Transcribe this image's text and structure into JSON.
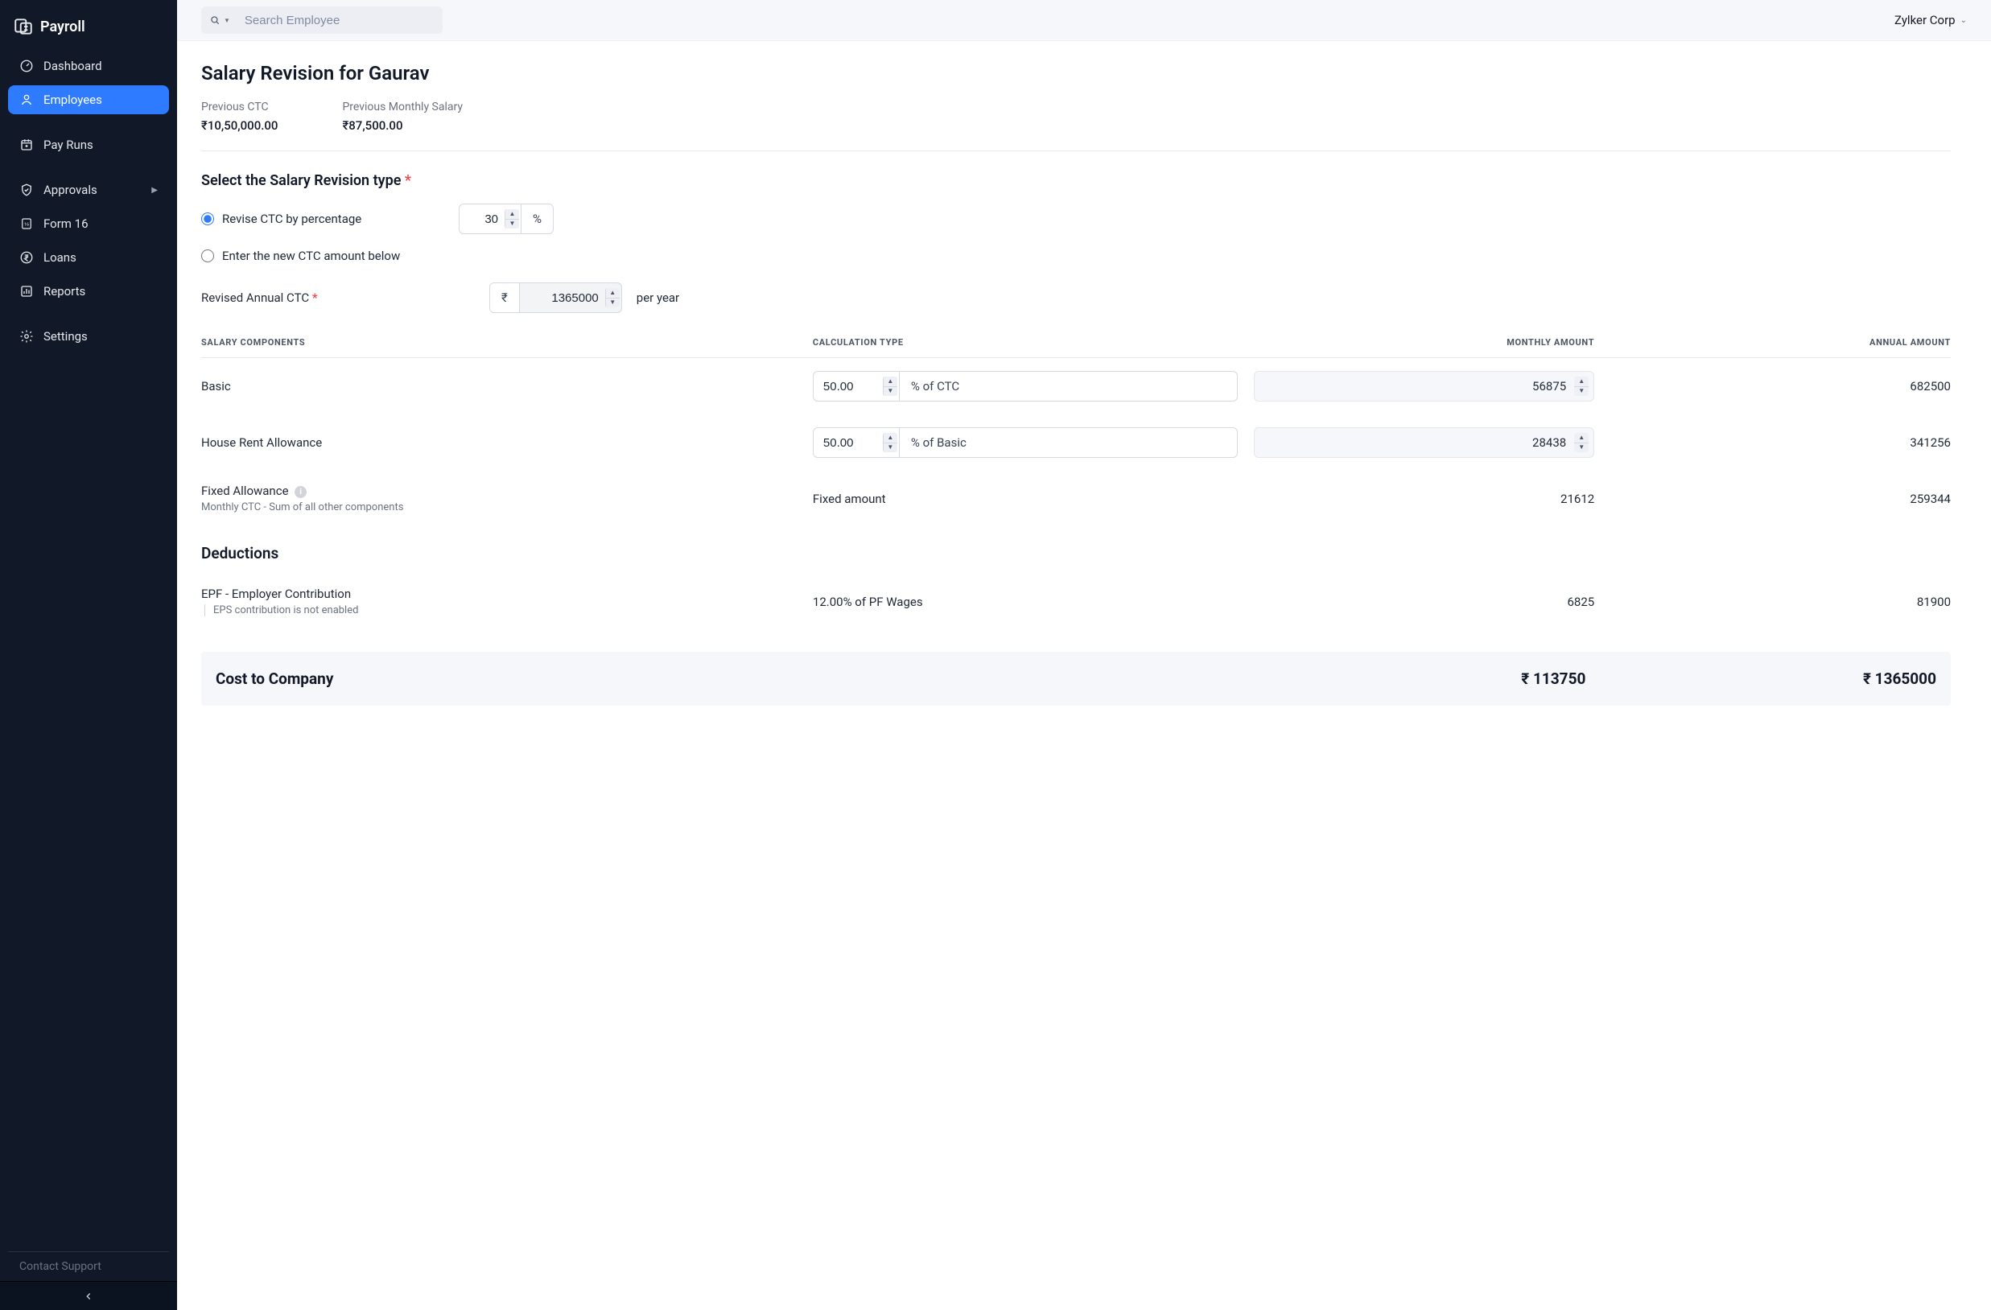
{
  "brand": {
    "name": "Payroll"
  },
  "sidebar": {
    "dashboard": "Dashboard",
    "employees": "Employees",
    "payruns": "Pay Runs",
    "approvals": "Approvals",
    "form16": "Form 16",
    "loans": "Loans",
    "reports": "Reports",
    "settings": "Settings",
    "support": "Contact Support"
  },
  "topbar": {
    "search_placeholder": "Search Employee",
    "org": "Zylker Corp"
  },
  "page": {
    "title": "Salary Revision for Gaurav",
    "prev_ctc_label": "Previous CTC",
    "prev_ctc_value": "₹10,50,000.00",
    "prev_monthly_label": "Previous Monthly Salary",
    "prev_monthly_value": "₹87,500.00",
    "revision_type_label": "Select the Salary Revision type",
    "radio1_label": "Revise CTC by percentage",
    "radio2_label": "Enter the new CTC amount below",
    "percent_value": "30",
    "percent_suffix": "%",
    "revised_label": "Revised Annual CTC",
    "revised_value": "1365000",
    "currency_symbol": "₹",
    "per_year": "per year"
  },
  "table": {
    "headers": {
      "components": "SALARY COMPONENTS",
      "calc": "CALCULATION TYPE",
      "monthly": "MONTHLY AMOUNT",
      "annual": "ANNUAL AMOUNT"
    },
    "basic": {
      "name": "Basic",
      "calc_value": "50.00",
      "calc_suffix": "% of CTC",
      "monthly": "56875",
      "annual": "682500"
    },
    "hra": {
      "name": "House Rent Allowance",
      "calc_value": "50.00",
      "calc_suffix": "% of Basic",
      "monthly": "28438",
      "annual": "341256"
    },
    "fixed": {
      "name": "Fixed Allowance",
      "sub": "Monthly CTC - Sum of all other components",
      "calc_text": "Fixed amount",
      "monthly": "21612",
      "annual": "259344"
    },
    "deductions_title": "Deductions",
    "epf": {
      "name": "EPF - Employer Contribution",
      "sub": "EPS contribution is not enabled",
      "calc_text": "12.00% of PF Wages",
      "monthly": "6825",
      "annual": "81900"
    }
  },
  "ctc": {
    "label": "Cost to Company",
    "monthly": "₹ 113750",
    "annual": "₹ 1365000"
  }
}
